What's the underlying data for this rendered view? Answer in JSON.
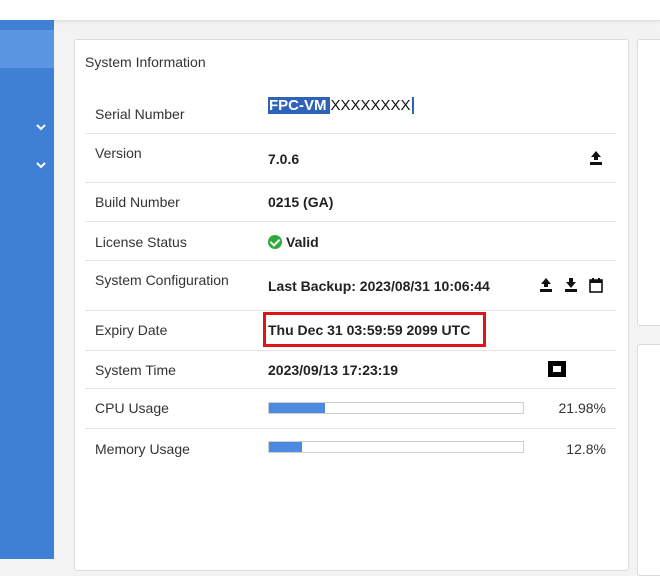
{
  "panel": {
    "title": "System Information"
  },
  "rows": {
    "serial": {
      "label": "Serial Number",
      "value_prefix": "FPC-VM",
      "value_rest": "XXXXXXXX"
    },
    "version": {
      "label": "Version",
      "value": "7.0.6",
      "icon": "upgrade-icon"
    },
    "build": {
      "label": "Build Number",
      "value": "0215 (GA)"
    },
    "license": {
      "label": "License Status",
      "value": "Valid",
      "icon": "check-circle-icon"
    },
    "config": {
      "label": "System Configuration",
      "value": "Last Backup: 2023/08/31 10:06:44",
      "icons": [
        "upload-icon",
        "download-icon",
        "calendar-icon"
      ]
    },
    "expiry": {
      "label": "Expiry Date",
      "value": "Thu Dec 31 03:59:59 2099 UTC"
    },
    "time": {
      "label": "System Time",
      "value": "2023/09/13 17:23:19"
    },
    "cpu": {
      "label": "CPU Usage",
      "percent_text": "21.98%",
      "fraction": 0.2198
    },
    "memory": {
      "label": "Memory Usage",
      "percent_text": "12.8%",
      "fraction": 0.128
    }
  },
  "colors": {
    "sidebar": "#3f7fd4",
    "bar_fill": "#4a8ae0",
    "valid_green": "#2eaa3a",
    "highlight_red": "#e0131b",
    "selection_blue": "#2f63b8"
  }
}
